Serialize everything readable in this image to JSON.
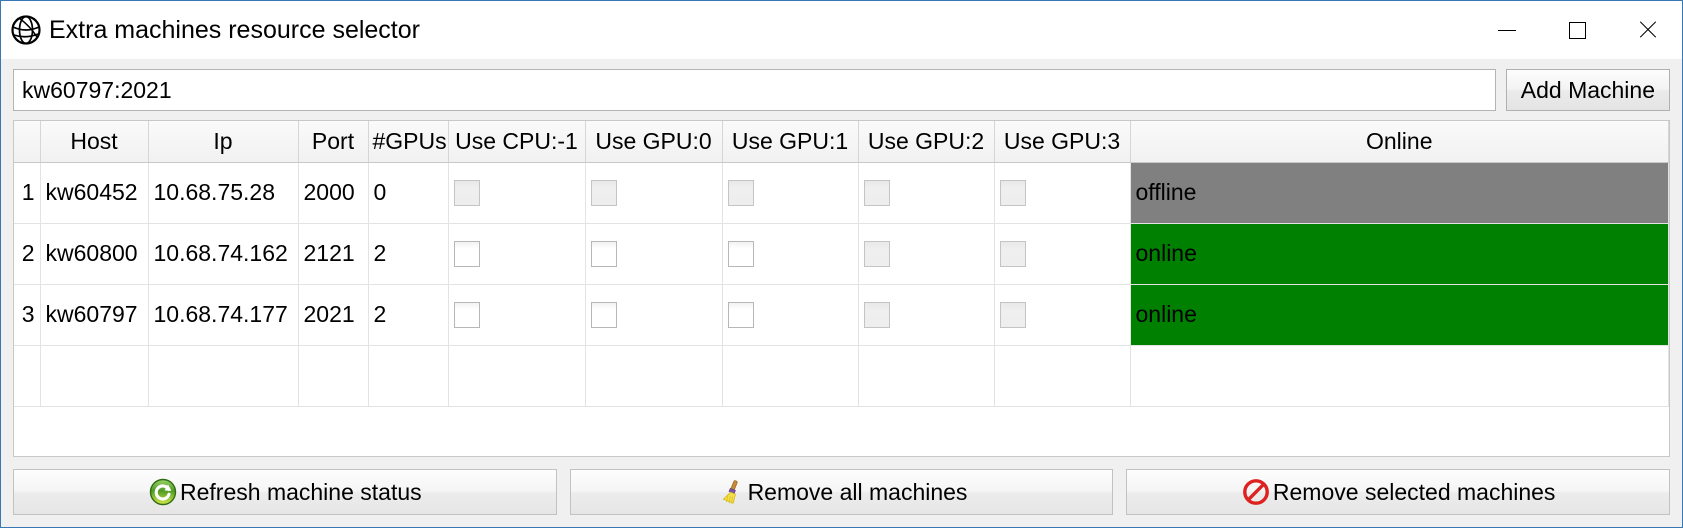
{
  "window": {
    "title": "Extra machines resource selector",
    "icon": "globe-icon",
    "minimize_label": "Minimize",
    "maximize_label": "Maximize",
    "close_label": "Close"
  },
  "toolbar": {
    "machine_input_value": "kw60797:2021",
    "machine_input_placeholder": "host:port",
    "add_machine_label": "Add Machine"
  },
  "table": {
    "corner_label": "",
    "columns": [
      "Host",
      "Ip",
      "Port",
      "#GPUs",
      "Use CPU:-1",
      "Use GPU:0",
      "Use GPU:1",
      "Use GPU:2",
      "Use GPU:3",
      "Online"
    ],
    "rows": [
      {
        "index": "1",
        "host": "kw60452",
        "ip": "10.68.75.28",
        "port": "2000",
        "gpus": "0",
        "use_cpu": {
          "checked": false,
          "enabled": false
        },
        "use_gpu0": {
          "checked": false,
          "enabled": false
        },
        "use_gpu1": {
          "checked": false,
          "enabled": false
        },
        "use_gpu2": {
          "checked": false,
          "enabled": false
        },
        "use_gpu3": {
          "checked": false,
          "enabled": false
        },
        "online": "offline",
        "online_color": "#808080"
      },
      {
        "index": "2",
        "host": "kw60800",
        "ip": "10.68.74.162",
        "port": "2121",
        "gpus": "2",
        "use_cpu": {
          "checked": false,
          "enabled": true
        },
        "use_gpu0": {
          "checked": false,
          "enabled": true
        },
        "use_gpu1": {
          "checked": false,
          "enabled": true
        },
        "use_gpu2": {
          "checked": false,
          "enabled": false
        },
        "use_gpu3": {
          "checked": false,
          "enabled": false
        },
        "online": "online",
        "online_color": "#008000"
      },
      {
        "index": "3",
        "host": "kw60797",
        "ip": "10.68.74.177",
        "port": "2021",
        "gpus": "2",
        "use_cpu": {
          "checked": false,
          "enabled": true
        },
        "use_gpu0": {
          "checked": false,
          "enabled": true
        },
        "use_gpu1": {
          "checked": false,
          "enabled": true
        },
        "use_gpu2": {
          "checked": false,
          "enabled": false
        },
        "use_gpu3": {
          "checked": false,
          "enabled": false
        },
        "online": "online",
        "online_color": "#008000"
      }
    ]
  },
  "actions": [
    {
      "label": "Refresh machine status",
      "icon": "refresh-icon"
    },
    {
      "label": "Remove all machines",
      "icon": "broom-icon"
    },
    {
      "label": "Remove selected machines",
      "icon": "prohibition-icon"
    }
  ],
  "colors": {
    "online": "#008000",
    "offline": "#808080",
    "window_border": "#3a78b5",
    "client_background": "#f0f0f0"
  }
}
